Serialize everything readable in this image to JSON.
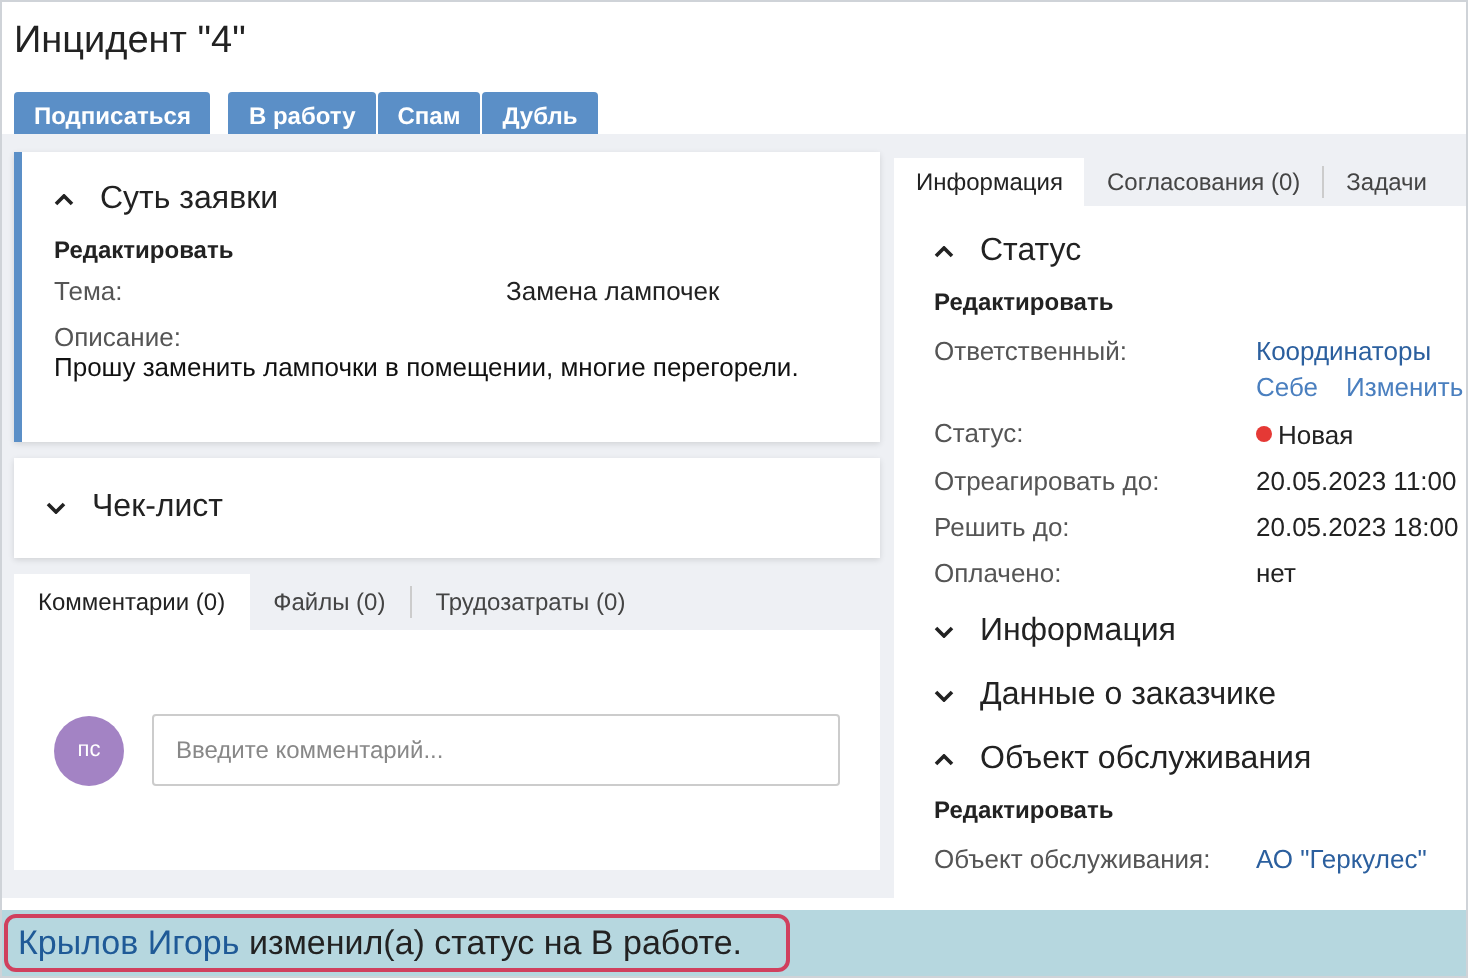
{
  "title": "Инцидент \"4\"",
  "button_groups": [
    [
      "Подписаться"
    ],
    [
      "В работу",
      "Спам",
      "Дубль"
    ]
  ],
  "summary": {
    "title": "Суть заявки",
    "expanded": true,
    "edit_link": "Редактировать",
    "fields": [
      {
        "label": "Тема:",
        "value": "Замена лампочек"
      }
    ],
    "description_label": "Описание:",
    "description": "Прошу заменить лампочки в помещении, многие перегорели."
  },
  "checklist": {
    "title": "Чек-лист",
    "expanded": false
  },
  "bottom_tabs": [
    {
      "label": "Комментарии (0)",
      "selected": true
    },
    {
      "label": "Файлы (0)",
      "selected": false
    },
    {
      "label": "Трудозатраты (0)",
      "selected": false
    }
  ],
  "comment": {
    "avatar": "пс",
    "placeholder": "Введите комментарий..."
  },
  "side_tabs": [
    {
      "label": "Информация",
      "selected": true
    },
    {
      "label": "Согласования (0)",
      "selected": false
    },
    {
      "label": "Задачи",
      "selected": false
    }
  ],
  "sections": [
    {
      "title": "Статус",
      "expanded": true,
      "edit_link": "Редактировать",
      "rows": [
        {
          "label": "Ответственный:",
          "value": "Координаторы",
          "kind": "link",
          "actions": [
            "Себе",
            "Изменить"
          ]
        },
        {
          "label": "Статус:",
          "value": "Новая",
          "kind": "status",
          "color": "#e53935"
        },
        {
          "label": "Отреагировать до:",
          "value": "20.05.2023 11:00",
          "kind": "text"
        },
        {
          "label": "Решить до:",
          "value": "20.05.2023 18:00",
          "kind": "text"
        },
        {
          "label": "Оплачено:",
          "value": "нет",
          "kind": "text"
        }
      ]
    },
    {
      "title": "Информация",
      "expanded": false
    },
    {
      "title": "Данные о заказчике",
      "expanded": false
    },
    {
      "title": "Объект обслуживания",
      "expanded": true,
      "edit_link": "Редактировать",
      "rows": [
        {
          "label": "Объект обслуживания:",
          "value": "АО \"Геркулес\"",
          "kind": "link"
        }
      ]
    }
  ],
  "notification": {
    "actor": "Крылов Игорь",
    "text": "изменил(а) статус на В работе."
  }
}
